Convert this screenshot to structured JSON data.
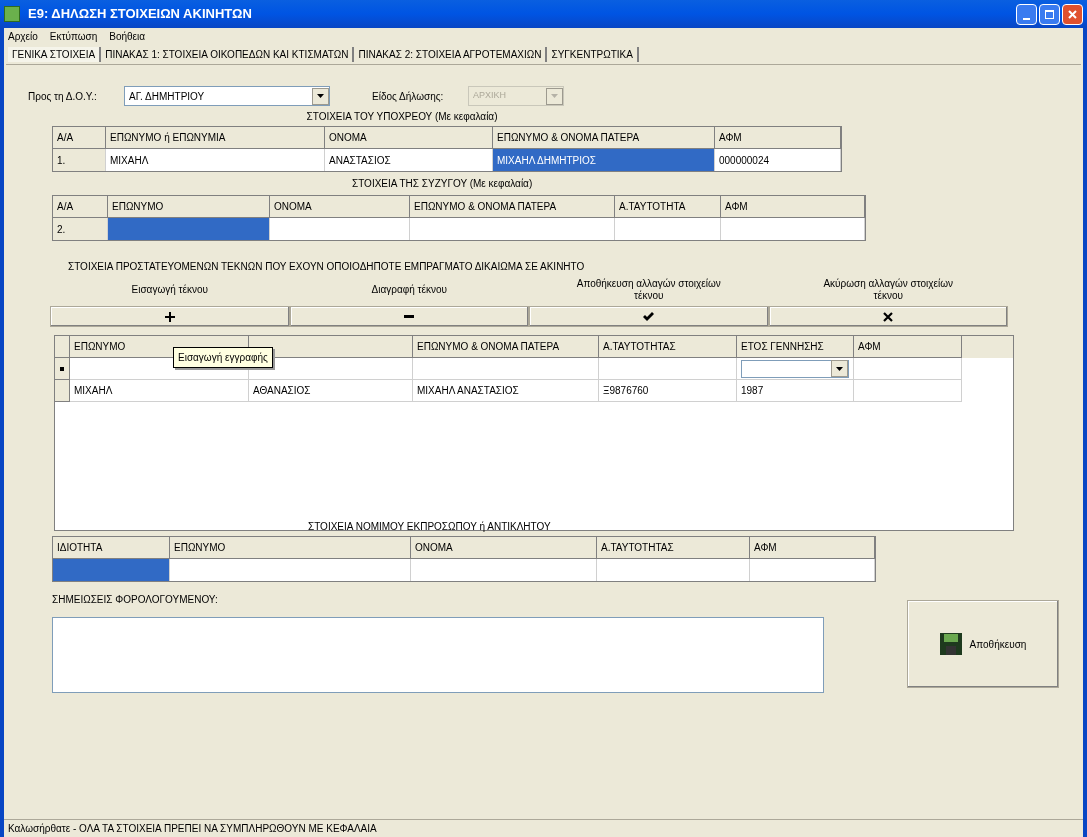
{
  "window": {
    "title": "Ε9: ΔΗΛΩΣΗ ΣΤΟΙΧΕΙΩΝ ΑΚΙΝΗΤΩΝ"
  },
  "menu": [
    "Αρχείο",
    "Εκτύπωση",
    "Βοήθεια"
  ],
  "tabs": [
    {
      "label": "ΓΕΝΙΚΑ ΣΤΟΙΧΕΙΑ",
      "selected": true
    },
    {
      "label": "ΠΙΝΑΚΑΣ 1: ΣΤΟΙΧΕΙΑ ΟΙΚΟΠΕΔΩΝ ΚΑΙ ΚΤΙΣΜΑΤΩΝ",
      "selected": false
    },
    {
      "label": "ΠΙΝΑΚΑΣ 2: ΣΤΟΙΧΕΙΑ ΑΓΡΟΤΕΜΑΧΙΩΝ",
      "selected": false
    },
    {
      "label": "ΣΥΓΚΕΝΤΡΩΤΙΚΑ",
      "selected": false
    }
  ],
  "doy": {
    "label": "Προς τη Δ.Ο.Υ.:",
    "value": "ΑΓ. ΔΗΜΗΤΡΙΟΥ",
    "disabled": false
  },
  "declaration_type": {
    "label": "Είδος Δήλωσης:",
    "value": "ΑΡΧΙΚΗ",
    "disabled": true
  },
  "obligor": {
    "heading": "ΣΤΟΙΧΕΙΑ ΤΟΥ ΥΠΟΧΡΕΟΥ (Με κεφαλαία)",
    "columns": [
      "Α/Α",
      "ΕΠΩΝΥΜΟ ή ΕΠΩΝΥΜΙΑ",
      "ΟΝΟΜΑ",
      "ΕΠΩΝΥΜΟ & ΟΝΟΜΑ ΠΑΤΕΡΑ",
      "ΑΦΜ"
    ],
    "rows": [
      [
        {
          "text": "1.",
          "selected": false
        },
        {
          "text": "ΜΙΧΑΗΛ",
          "selected": false
        },
        {
          "text": "ΑΝΑΣΤΑΣΙΟΣ",
          "selected": false
        },
        {
          "text": "ΜΙΧΑΗΛ ΔΗΜΗΤΡΙΟΣ",
          "selected": true
        },
        {
          "text": "000000024",
          "selected": false
        }
      ]
    ]
  },
  "spouse": {
    "heading": "ΣΤΟΙΧΕΙΑ ΤΗΣ ΣΥΖΥΓΟΥ (Με κεφαλαία)",
    "columns": [
      "Α/Α",
      "ΕΠΩΝΥΜΟ",
      "ΟΝΟΜΑ",
      "ΕΠΩΝΥΜΟ & ΟΝΟΜΑ ΠΑΤΕΡΑ",
      "Α.ΤΑΥΤΟΤΗΤΑ",
      "ΑΦΜ"
    ],
    "rows": [
      [
        {
          "text": "2.",
          "selected": false
        },
        {
          "selected": true
        },
        {
          "selected": false
        },
        {
          "selected": false
        },
        {
          "selected": false
        },
        {
          "selected": false
        }
      ]
    ]
  },
  "children": {
    "heading": "ΣΤΟΙΧΕΙΑ ΠΡΟΣΤΑΤΕΥΟΜΕΝΩΝ ΤΕΚΝΩΝ ΠΟΥ ΕΧΟΥΝ ΟΠΟΙΟΔΗΠΟΤΕ ΕΜΠΡΑΓΜΑΤΟ ΔΙΚΑΙΩΜΑ ΣΕ ΑΚΙΝΗΤΟ",
    "actions": [
      {
        "label": "Εισαγωγή τέκνου",
        "kind": "plus"
      },
      {
        "label": "Διαγραφή τέκνου",
        "kind": "minus"
      },
      {
        "label": "Αποθήκευση αλλαγών στοιχείων τέκνου",
        "kind": "check"
      },
      {
        "label": "Ακύρωση αλλαγών στοιχείων τέκνου",
        "kind": "cross"
      }
    ],
    "columns": [
      "ΕΠΩΝΥΜΟ",
      null,
      "ΕΠΩΝΥΜΟ & ΟΝΟΜΑ ΠΑΤΕΡΑ",
      "Α.ΤΑΥΤΟΤΗΤΑΣ",
      "ΕΤΟΣ ΓΕΝΝΗΣΗΣ",
      "ΑΦΜ"
    ],
    "tooltip": "Εισαγωγή εγγραφής",
    "rows": [
      {
        "kind": "new",
        "cells": []
      },
      {
        "kind": "data",
        "cells": [
          "ΜΙΧΑΗΛ",
          "ΑΘΑΝΑΣΙΟΣ",
          "ΜΙΧΑΗΛ ΑΝΑΣΤΑΣΙΟΣ",
          "Ξ9876760",
          "1987"
        ]
      }
    ]
  },
  "representative": {
    "heading": "ΣΤΟΙΧΕΙΑ ΝΟΜΙΜΟΥ ΕΚΠΡΟΣΩΠΟΥ ή ΑΝΤΙΚΛΗΤΟΥ",
    "columns": [
      "ΙΔΙΟΤΗΤΑ",
      "ΕΠΩΝΥΜΟ",
      "ΟΝΟΜΑ",
      "Α.ΤΑΥΤΟΤΗΤΑΣ",
      "ΑΦΜ"
    ],
    "rows": [
      [
        {
          "selected": true
        },
        {
          "selected": false
        },
        {
          "selected": false
        },
        {
          "selected": false
        },
        {
          "selected": false
        }
      ]
    ]
  },
  "notes": {
    "label": "ΣΗΜΕΙΩΣΕΙΣ ΦΟΡΟΛΟΓΟΥΜΕΝΟΥ:"
  },
  "save_button": "Αποθήκευση",
  "status_bar": "Καλωσήρθατε - ΟΛΑ ΤΑ ΣΤΟΙΧΕΙΑ ΠΡΕΠΕΙ ΝΑ ΣΥΜΠΛΗΡΩΘΟΥΝ ΜΕ ΚΕΦΑΛΑΙΑ"
}
